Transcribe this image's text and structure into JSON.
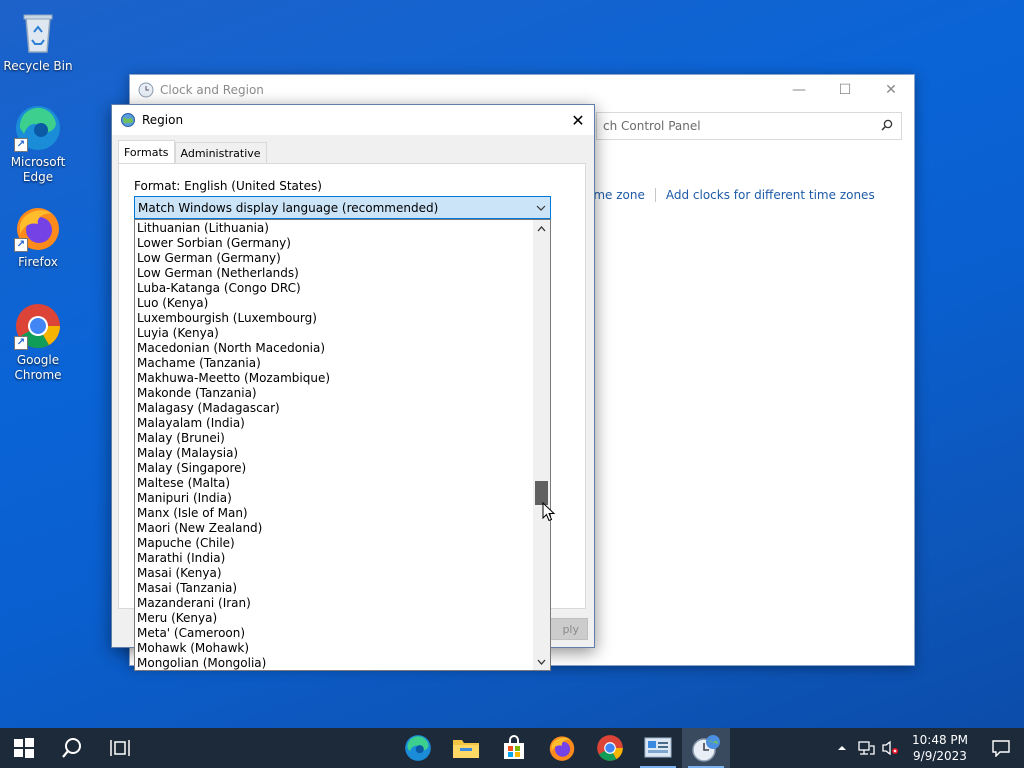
{
  "desktop": {
    "icons": [
      {
        "label": "Recycle Bin",
        "icon": "recycle-bin-icon"
      },
      {
        "label": "Microsoft Edge",
        "icon": "edge-icon"
      },
      {
        "label": "Firefox",
        "icon": "firefox-icon"
      },
      {
        "label": "Google Chrome",
        "icon": "chrome-icon"
      }
    ]
  },
  "clock_region_window": {
    "title": "Clock and Region",
    "search_text": "ch Control Panel",
    "links": [
      "ime zone",
      "Add clocks for different time zones"
    ]
  },
  "region_dialog": {
    "title": "Region",
    "close_label": "✕",
    "tabs": [
      "Formats",
      "Administrative"
    ],
    "format_label": "Format: English (United States)",
    "selected_format": "Match Windows display language (recommended)",
    "apply_label": "ply",
    "dropdown_items": [
      "Lithuanian (Lithuania)",
      "Lower Sorbian (Germany)",
      "Low German (Germany)",
      "Low German (Netherlands)",
      "Luba-Katanga (Congo DRC)",
      "Luo (Kenya)",
      "Luxembourgish (Luxembourg)",
      "Luyia (Kenya)",
      "Macedonian (North Macedonia)",
      "Machame (Tanzania)",
      "Makhuwa-Meetto (Mozambique)",
      "Makonde (Tanzania)",
      "Malagasy (Madagascar)",
      "Malayalam (India)",
      "Malay (Brunei)",
      "Malay (Malaysia)",
      "Malay (Singapore)",
      "Maltese (Malta)",
      "Manipuri (India)",
      "Manx (Isle of Man)",
      "Maori (New Zealand)",
      "Mapuche (Chile)",
      "Marathi (India)",
      "Masai (Kenya)",
      "Masai (Tanzania)",
      "Mazanderani (Iran)",
      "Meru (Kenya)",
      "Meta' (Cameroon)",
      "Mohawk (Mohawk)",
      "Mongolian (Mongolia)"
    ],
    "scroll_position": 0.62
  },
  "taskbar": {
    "time": "10:48 PM",
    "date": "9/9/2023",
    "pinned": [
      "start-icon",
      "search-icon",
      "task-view-icon",
      "edge-icon",
      "file-explorer-icon",
      "store-icon",
      "firefox-icon",
      "chrome-icon",
      "control-panel-icon",
      "clock-region-icon"
    ]
  },
  "colors": {
    "accent": "#0078d7",
    "combo_bg": "#cce4f7",
    "taskbar": "#1c2a3a",
    "link": "#1e5aa8"
  }
}
